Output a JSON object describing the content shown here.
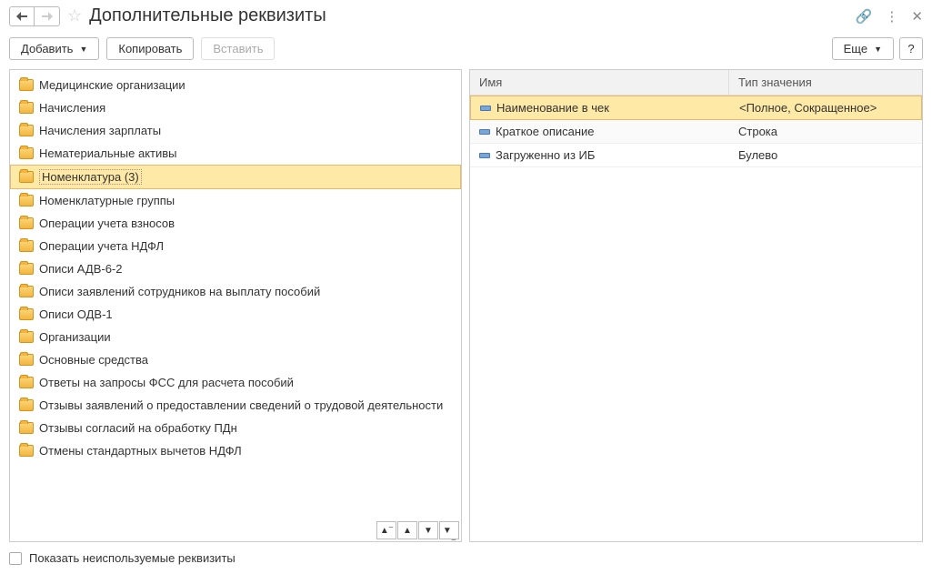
{
  "header": {
    "title": "Дополнительные реквизиты"
  },
  "toolbar": {
    "add": "Добавить",
    "copy": "Копировать",
    "paste": "Вставить",
    "more": "Еще",
    "help": "?"
  },
  "tree": {
    "items": [
      {
        "label": "Медицинские организации",
        "selected": false
      },
      {
        "label": "Начисления",
        "selected": false
      },
      {
        "label": "Начисления зарплаты",
        "selected": false
      },
      {
        "label": "Нематериальные активы",
        "selected": false
      },
      {
        "label": "Номенклатура (3)",
        "selected": true
      },
      {
        "label": "Номенклатурные группы",
        "selected": false
      },
      {
        "label": "Операции учета взносов",
        "selected": false
      },
      {
        "label": "Операции учета НДФЛ",
        "selected": false
      },
      {
        "label": "Описи АДВ-6-2",
        "selected": false
      },
      {
        "label": "Описи заявлений сотрудников на выплату пособий",
        "selected": false
      },
      {
        "label": "Описи ОДВ-1",
        "selected": false
      },
      {
        "label": "Организации",
        "selected": false
      },
      {
        "label": "Основные средства",
        "selected": false
      },
      {
        "label": "Ответы на запросы ФСС для расчета пособий",
        "selected": false
      },
      {
        "label": "Отзывы заявлений о предоставлении сведений о трудовой деятельности",
        "selected": false
      },
      {
        "label": "Отзывы согласий на обработку ПДн",
        "selected": false
      },
      {
        "label": "Отмены стандартных вычетов НДФЛ",
        "selected": false
      }
    ]
  },
  "table": {
    "columns": {
      "name": "Имя",
      "type": "Тип значения"
    },
    "rows": [
      {
        "name": "Наименование в чек",
        "type": "<Полное, Сокращенное>",
        "selected": true
      },
      {
        "name": "Краткое описание",
        "type": "Строка",
        "selected": false
      },
      {
        "name": "Загруженно из ИБ",
        "type": "Булево",
        "selected": false
      }
    ]
  },
  "footer": {
    "checkbox_label": "Показать неиспользуемые реквизиты"
  }
}
